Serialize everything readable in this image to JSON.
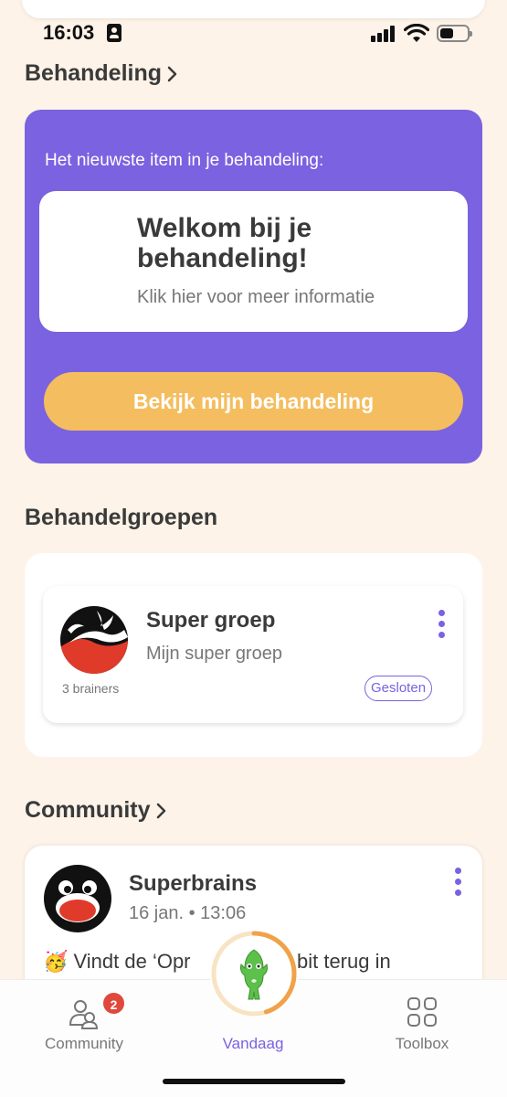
{
  "status_bar": {
    "time": "16:03"
  },
  "treatment": {
    "title": "Behandeling",
    "intro": "Het nieuwste item in je behandeling:",
    "item_title": "Welkom bij je behandeling!",
    "item_subtitle": "Klik hier voor meer informatie",
    "button_label": "Bekijk mijn behandeling",
    "accent_color": "#7a62e0",
    "button_color": "#f4bd5f"
  },
  "groups": {
    "title": "Behandelgroepen",
    "items": [
      {
        "name": "Super groep",
        "description": "Mijn super groep",
        "members": "3 brainers",
        "status": "Gesloten"
      }
    ]
  },
  "community": {
    "title": "Community",
    "post": {
      "author": "Superbrains",
      "date": "16 jan. • 13:06",
      "text_before": "🥳 Vindt de ‘Opr",
      "text_after": "habit terug in"
    }
  },
  "tabbar": {
    "tabs": [
      {
        "label": "Community",
        "icon": "people-icon",
        "badge": "2"
      },
      {
        "label": "Vandaag",
        "icon": "mascot-icon",
        "progress": 0.45
      },
      {
        "label": "Toolbox",
        "icon": "grid-icon"
      }
    ],
    "active_color": "#7a62e0"
  }
}
